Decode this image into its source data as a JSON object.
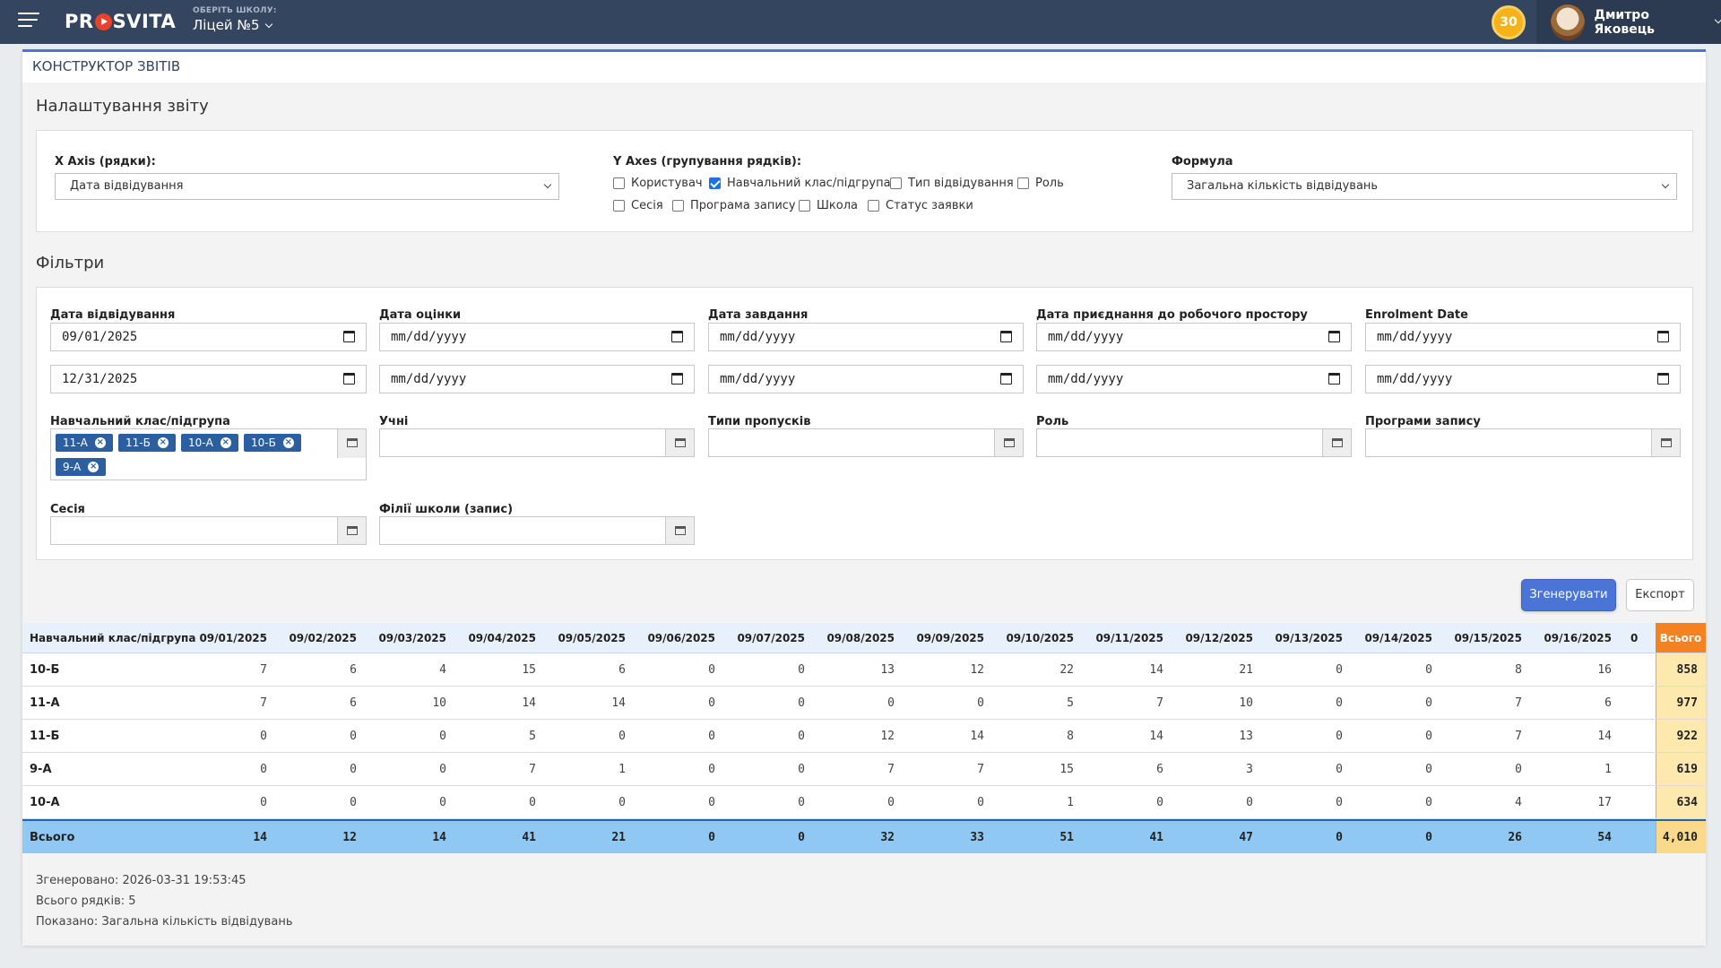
{
  "header": {
    "logo": "PROSVITA",
    "logo_pre": "PR",
    "logo_post": "SVITA",
    "school_hint": "ОБЕРІТЬ ШКОЛУ:",
    "school_name": "Ліцей №5",
    "coins": "30",
    "user_name": "Дмитро Яковець"
  },
  "page": {
    "title": "КОНСТРУКТОР ЗВІТІВ"
  },
  "settings": {
    "title": "Налаштування звіту",
    "x_axis_label": "X Axis (рядки):",
    "x_axis_value": "Дата відвідування",
    "y_axes_label": "Y Axes (групування рядків):",
    "y_axes": [
      {
        "label": "Користувач",
        "checked": false
      },
      {
        "label": "Навчальний клас/підгрупа",
        "checked": true
      },
      {
        "label": "Тип відвідування",
        "checked": false
      },
      {
        "label": "Роль",
        "checked": false
      },
      {
        "label": "Сесія",
        "checked": false
      },
      {
        "label": "Програма запису",
        "checked": false
      },
      {
        "label": "Школа",
        "checked": false
      },
      {
        "label": "Статус заявки",
        "checked": false
      }
    ],
    "formula_label": "Формула",
    "formula_value": "Загальна кількість відвідувань"
  },
  "filters": {
    "title": "Фільтри",
    "dates": [
      {
        "label": "Дата відвідування",
        "from": "09/01/2025",
        "to": "12/31/2025"
      },
      {
        "label": "Дата оцінки",
        "from": "mm/dd/yyyy",
        "to": "mm/dd/yyyy"
      },
      {
        "label": "Дата завдання",
        "from": "mm/dd/yyyy",
        "to": "mm/dd/yyyy"
      },
      {
        "label": "Дата приєднання до робочого простору",
        "from": "mm/dd/yyyy",
        "to": "mm/dd/yyyy"
      },
      {
        "label": "Enrolment Date",
        "from": "mm/dd/yyyy",
        "to": "mm/dd/yyyy"
      }
    ],
    "class_label": "Навчальний клас/підгрупа",
    "class_tags": [
      "11-А",
      "11-Б",
      "10-А",
      "10-Б",
      "9-А"
    ],
    "students_label": "Учні",
    "absence_label": "Типи пропусків",
    "role_label": "Роль",
    "programs_label": "Програми запису",
    "session_label": "Сесія",
    "branches_label": "Філії школи (запис)"
  },
  "actions": {
    "generate": "Згенерувати",
    "export": "Експорт"
  },
  "table": {
    "first_header": "Навчальний клас/підгрупа",
    "dates": [
      "09/01/2025",
      "09/02/2025",
      "09/03/2025",
      "09/04/2025",
      "09/05/2025",
      "09/06/2025",
      "09/07/2025",
      "09/08/2025",
      "09/09/2025",
      "09/10/2025",
      "09/11/2025",
      "09/12/2025",
      "09/13/2025",
      "09/14/2025",
      "09/15/2025",
      "09/16/2025"
    ],
    "overflow_header": "0",
    "sum_header": "Всього",
    "rows": [
      {
        "name": "10-Б",
        "values": [
          "7",
          "6",
          "4",
          "15",
          "6",
          "0",
          "0",
          "13",
          "12",
          "22",
          "14",
          "21",
          "0",
          "0",
          "8",
          "16"
        ],
        "total": "858"
      },
      {
        "name": "11-А",
        "values": [
          "7",
          "6",
          "10",
          "14",
          "14",
          "0",
          "0",
          "0",
          "0",
          "5",
          "7",
          "10",
          "0",
          "0",
          "7",
          "6"
        ],
        "total": "977"
      },
      {
        "name": "11-Б",
        "values": [
          "0",
          "0",
          "0",
          "5",
          "0",
          "0",
          "0",
          "12",
          "14",
          "8",
          "14",
          "13",
          "0",
          "0",
          "7",
          "14"
        ],
        "total": "922"
      },
      {
        "name": "9-А",
        "values": [
          "0",
          "0",
          "0",
          "7",
          "1",
          "0",
          "0",
          "7",
          "7",
          "15",
          "6",
          "3",
          "0",
          "0",
          "0",
          "1"
        ],
        "total": "619"
      },
      {
        "name": "10-А",
        "values": [
          "0",
          "0",
          "0",
          "0",
          "0",
          "0",
          "0",
          "0",
          "0",
          "1",
          "0",
          "0",
          "0",
          "0",
          "4",
          "17"
        ],
        "total": "634"
      }
    ],
    "totals_row": {
      "name": "Всього",
      "values": [
        "14",
        "12",
        "14",
        "41",
        "21",
        "0",
        "0",
        "32",
        "33",
        "51",
        "41",
        "47",
        "0",
        "0",
        "26",
        "54"
      ],
      "total": "4,010"
    }
  },
  "footer": {
    "generated": "Згенеровано: 2026-03-31 19:53:45",
    "rows_count": "Всього рядків: 5",
    "shown": "Показано: Загальна кількість відвідувань"
  }
}
